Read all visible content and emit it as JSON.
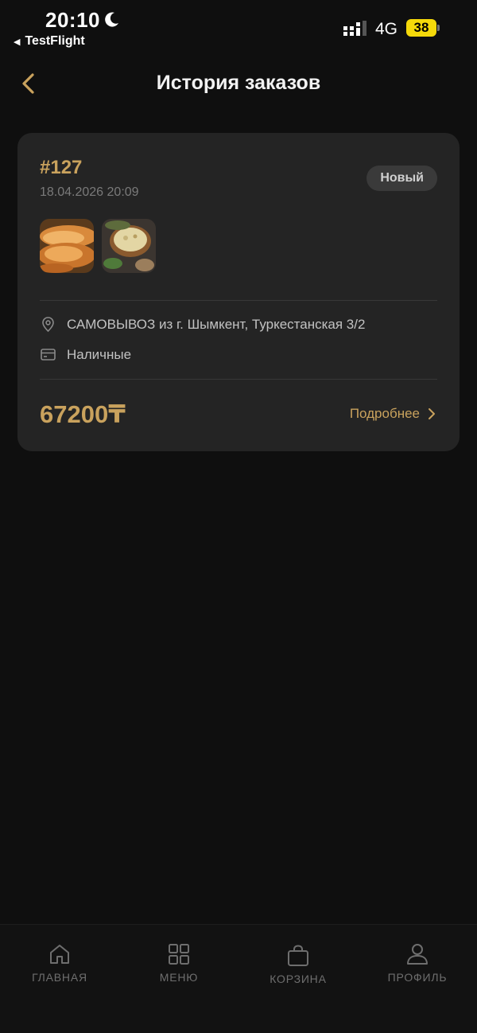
{
  "status_bar": {
    "time": "20:10",
    "back_app": "TestFlight",
    "network": "4G",
    "battery": "38"
  },
  "header": {
    "title": "История заказов"
  },
  "order": {
    "number": "#127",
    "date": "18.04.2026 20:09",
    "status": "Новый",
    "address": "САМОВЫВОЗ из г. Шымкент, Туркестанская 3/2",
    "payment": "Наличные",
    "total": "67200₸",
    "details_label": "Подробнее"
  },
  "nav": {
    "home": "ГЛАВНАЯ",
    "menu": "МЕНЮ",
    "cart": "КОРЗИНА",
    "profile": "ПРОФИЛЬ"
  },
  "colors": {
    "background": "#0f0f0f",
    "card": "#242424",
    "accent": "#c9a25d",
    "battery": "#f5d90a"
  }
}
